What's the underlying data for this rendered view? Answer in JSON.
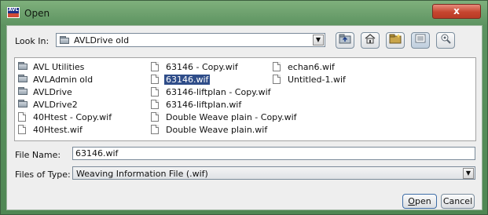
{
  "window": {
    "title": "Open",
    "app_icon_text": "AVL",
    "close_label": "x"
  },
  "look_in": {
    "label": "Look In:",
    "value": "AVLDrive old"
  },
  "toolbar": {
    "up_icon": "up-folder-icon",
    "home_icon": "home-icon",
    "new_folder_icon": "new-folder-icon",
    "list_icon": "list-view-icon",
    "details_icon": "details-view-icon"
  },
  "files": {
    "columns": [
      [
        {
          "name": "AVL Utilities",
          "type": "folder"
        },
        {
          "name": "AVLAdmin old",
          "type": "folder"
        },
        {
          "name": "AVLDrive",
          "type": "folder"
        },
        {
          "name": "AVLDrive2",
          "type": "folder"
        },
        {
          "name": "40Htest - Copy.wif",
          "type": "file"
        },
        {
          "name": "40Htest.wif",
          "type": "file"
        }
      ],
      [
        {
          "name": "63146 - Copy.wif",
          "type": "file"
        },
        {
          "name": "63146.wif",
          "type": "file",
          "selected": true
        },
        {
          "name": "63146-liftplan - Copy.wif",
          "type": "file"
        },
        {
          "name": "63146-liftplan.wif",
          "type": "file"
        },
        {
          "name": "Double Weave plain - Copy.wif",
          "type": "file"
        },
        {
          "name": "Double Weave plain.wif",
          "type": "file"
        }
      ],
      [
        {
          "name": "echan6.wif",
          "type": "file"
        },
        {
          "name": "Untitled-1.wif",
          "type": "file"
        }
      ]
    ]
  },
  "file_name": {
    "label": "File Name:",
    "value": "63146.wif"
  },
  "file_type": {
    "label": "Files of Type:",
    "value": "Weaving Information File (.wif)"
  },
  "buttons": {
    "open_mnemonic": "O",
    "open_rest": "pen",
    "cancel": "Cancel"
  }
}
